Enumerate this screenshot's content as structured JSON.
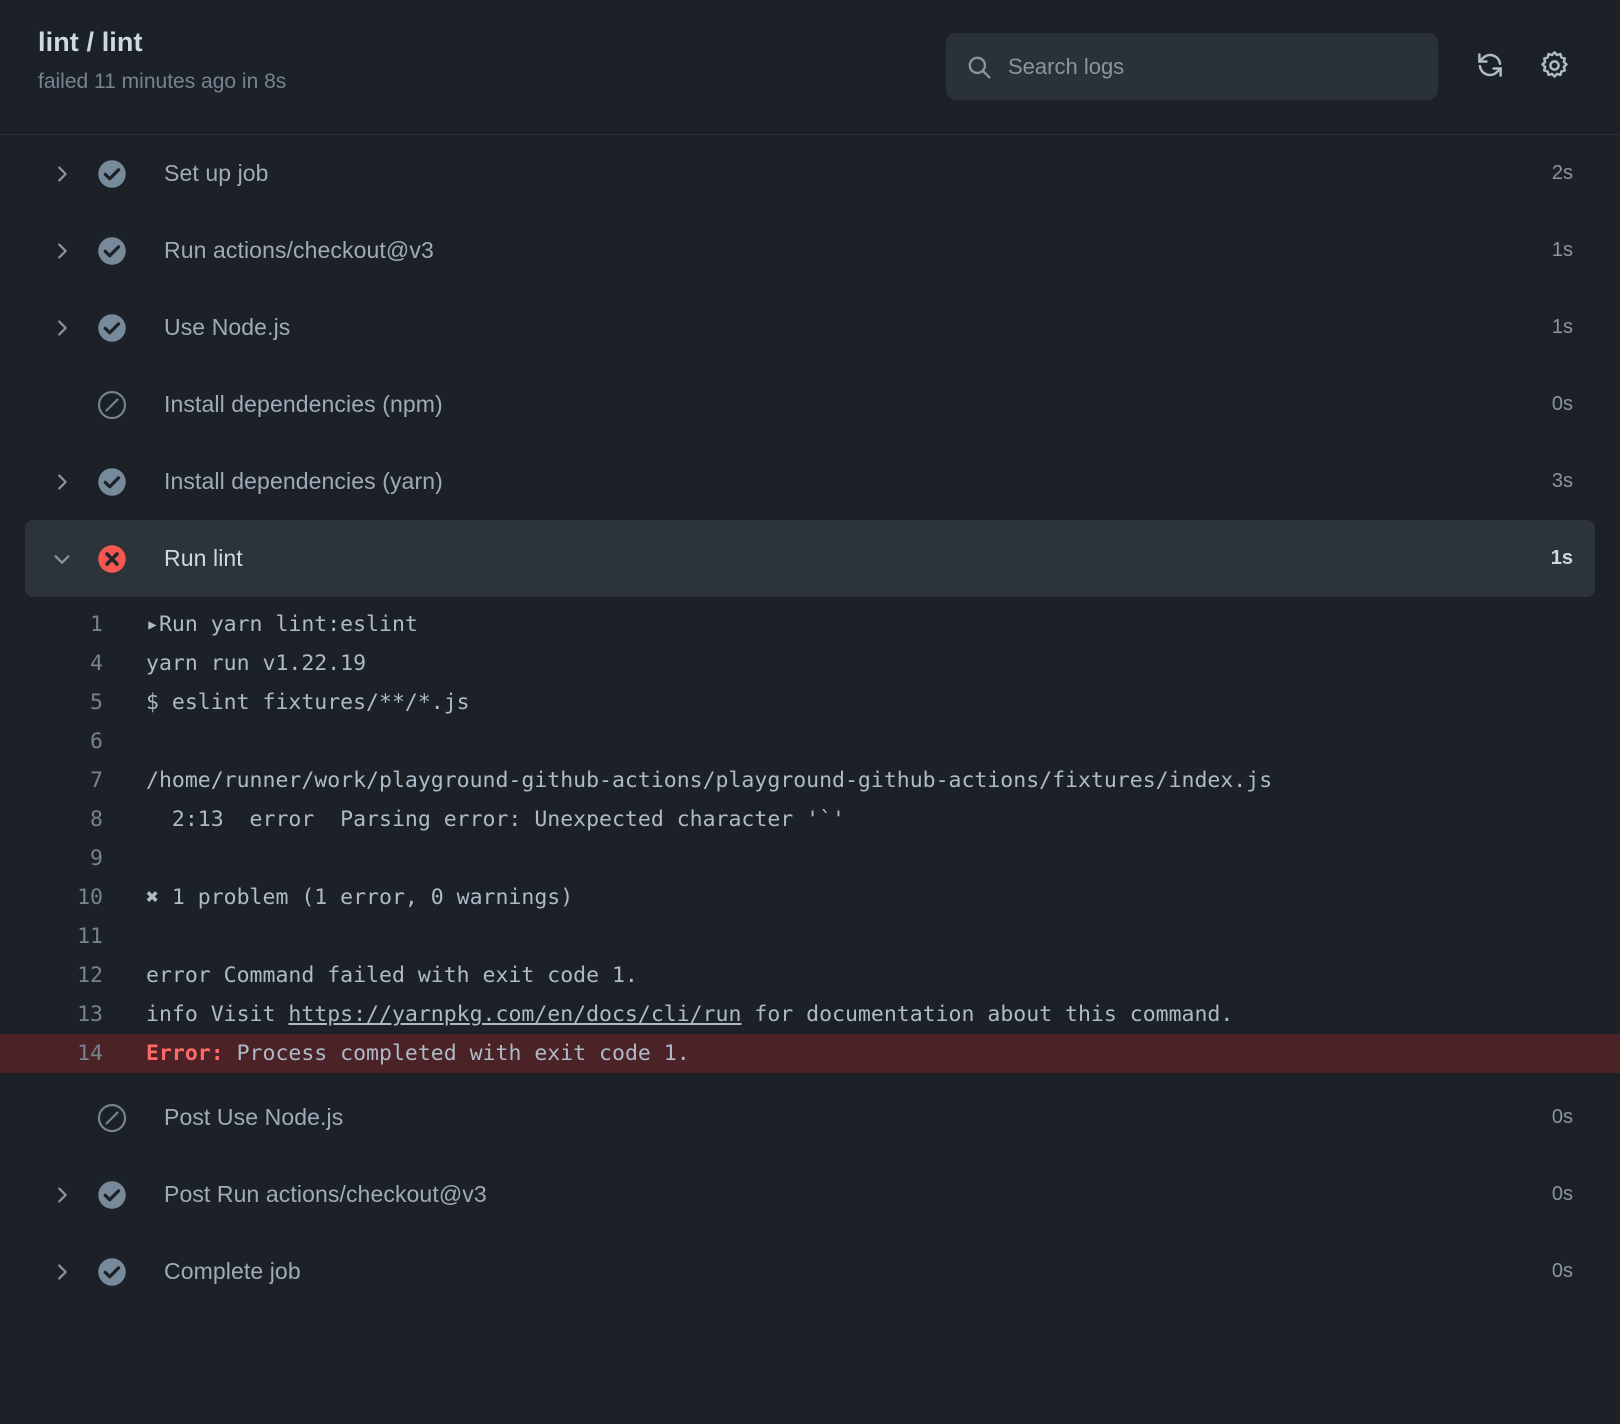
{
  "header": {
    "title": "lint / lint",
    "status": "failed 11 minutes ago in 8s",
    "search_placeholder": "Search logs",
    "search_value": "",
    "refresh_label": "refresh-icon",
    "settings_label": "gear-icon"
  },
  "steps": [
    {
      "name": "Set up job",
      "time": "2s",
      "status": "success",
      "expandable": true,
      "expanded": false
    },
    {
      "name": "Run actions/checkout@v3",
      "time": "1s",
      "status": "success",
      "expandable": true,
      "expanded": false
    },
    {
      "name": "Use Node.js",
      "time": "1s",
      "status": "success",
      "expandable": true,
      "expanded": false
    },
    {
      "name": "Install dependencies (npm)",
      "time": "0s",
      "status": "skipped",
      "expandable": false,
      "expanded": false
    },
    {
      "name": "Install dependencies (yarn)",
      "time": "3s",
      "status": "success",
      "expandable": true,
      "expanded": false
    },
    {
      "name": "Run lint",
      "time": "1s",
      "status": "failure",
      "expandable": true,
      "expanded": true
    },
    {
      "name": "Post Use Node.js",
      "time": "0s",
      "status": "skipped",
      "expandable": false,
      "expanded": false
    },
    {
      "name": "Post Run actions/checkout@v3",
      "time": "0s",
      "status": "success",
      "expandable": true,
      "expanded": false
    },
    {
      "name": "Complete job",
      "time": "0s",
      "status": "success",
      "expandable": true,
      "expanded": false
    }
  ],
  "log": {
    "lines": [
      {
        "num": "1",
        "kind": "group",
        "text": "Run yarn lint:eslint"
      },
      {
        "num": "4",
        "kind": "plain",
        "text": "yarn run v1.22.19"
      },
      {
        "num": "5",
        "kind": "plain",
        "text": "$ eslint fixtures/**/*.js"
      },
      {
        "num": "6",
        "kind": "plain",
        "text": ""
      },
      {
        "num": "7",
        "kind": "plain",
        "text": "/home/runner/work/playground-github-actions/playground-github-actions/fixtures/index.js"
      },
      {
        "num": "8",
        "kind": "plain",
        "text": "  2:13  error  Parsing error: Unexpected character '`'"
      },
      {
        "num": "9",
        "kind": "plain",
        "text": ""
      },
      {
        "num": "10",
        "kind": "plain",
        "text": "✖ 1 problem (1 error, 0 warnings)"
      },
      {
        "num": "11",
        "kind": "plain",
        "text": ""
      },
      {
        "num": "12",
        "kind": "plain",
        "text": "error Command failed with exit code 1."
      },
      {
        "num": "13",
        "kind": "link",
        "prefix": "info Visit ",
        "link": "https://yarnpkg.com/en/docs/cli/run",
        "suffix": " for documentation about this command."
      },
      {
        "num": "14",
        "kind": "error",
        "label": "Error:",
        "text": " Process completed with exit code 1."
      }
    ]
  },
  "colors": {
    "background": "#1c2128",
    "selected_row": "#2c333b",
    "error_row": "#4b2226",
    "error_text": "#ff6a69",
    "failure_icon": "#f4584f",
    "success_icon": "#768a99",
    "text": "#adbac7",
    "muted": "#768390"
  }
}
